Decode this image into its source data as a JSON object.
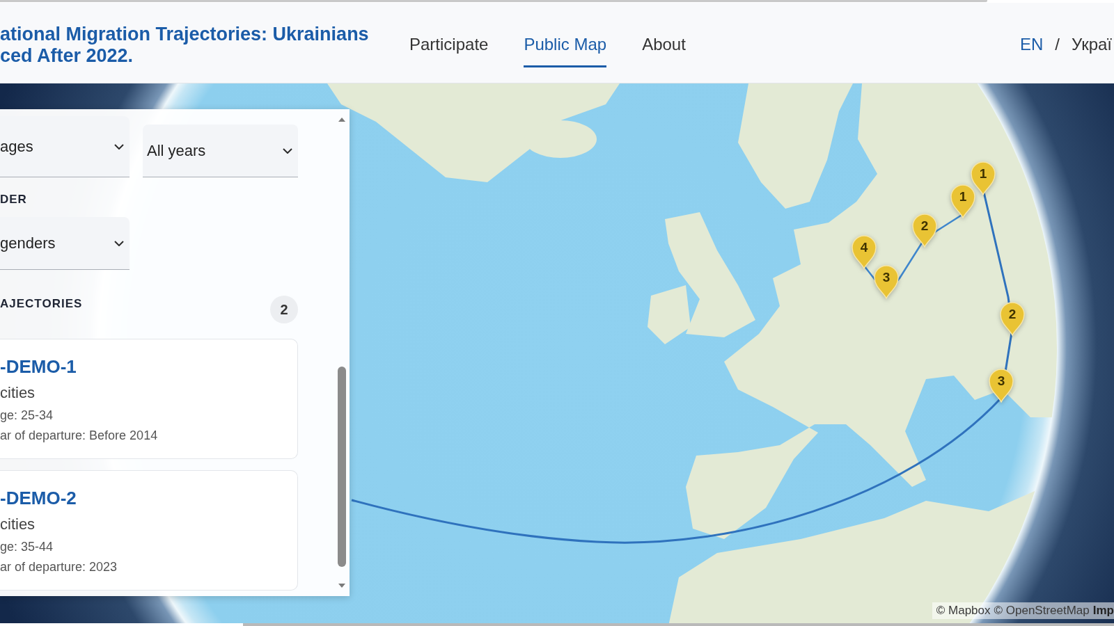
{
  "header": {
    "title_lines": [
      "ational Migration Trajectories: Ukrainians",
      "ced After 2022."
    ],
    "nav": [
      {
        "label": "Participate",
        "selected": false
      },
      {
        "label": "Public Map",
        "selected": true
      },
      {
        "label": "About",
        "selected": false
      }
    ],
    "languages": [
      {
        "label": "EN",
        "selected": true
      },
      {
        "label": "Украї",
        "selected": false
      }
    ],
    "language_separator": "/"
  },
  "filters": {
    "age_select": {
      "value": "ages"
    },
    "departure_select": {
      "value": "All years"
    },
    "gender": {
      "label": "DER",
      "select_value": "genders"
    }
  },
  "trajectories": {
    "label": "AJECTORIES",
    "count": "2",
    "items": [
      {
        "title": "-DEMO-1",
        "cities": "cities",
        "age": "ge: 25-34",
        "departure": "ar of departure: Before 2014"
      },
      {
        "title": "-DEMO-2",
        "cities": "cities",
        "age": "ge: 35-44",
        "departure": "ar of departure: 2023"
      }
    ]
  },
  "map": {
    "markers": [
      {
        "label": "1"
      },
      {
        "label": "1"
      },
      {
        "label": "2"
      },
      {
        "label": "4"
      },
      {
        "label": "3"
      },
      {
        "label": "2"
      },
      {
        "label": "3"
      }
    ],
    "attribution": [
      "© Mapbox",
      "© OpenStreetMap"
    ],
    "improve_link": "Imp"
  }
}
